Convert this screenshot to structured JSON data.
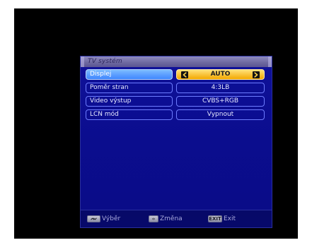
{
  "dialog": {
    "title": "TV systém"
  },
  "settings": [
    {
      "label": "Displej",
      "value": "AUTO"
    },
    {
      "label": "Poměr stran",
      "value": "4:3LB"
    },
    {
      "label": "Video výstup",
      "value": "CVBS+RGB"
    },
    {
      "label": "LCN mód",
      "value": "Vypnout"
    }
  ],
  "footer": {
    "select_label": "Výběr",
    "change_label": "Změna",
    "exit_key_label": "EXIT",
    "exit_label": "Exit"
  },
  "icons": {
    "left_arrow": "chevron-left-icon",
    "right_arrow": "chevron-right-icon",
    "select_key": "up-down-keys-icon",
    "change_key": "left-right-keys-icon"
  },
  "colors": {
    "background": "#ffffff",
    "screen": "#000000",
    "panel": "#0a0c86",
    "selected_label": "#3f86ff",
    "selected_value": "#f3a800",
    "row_border": "#6d7cff"
  }
}
